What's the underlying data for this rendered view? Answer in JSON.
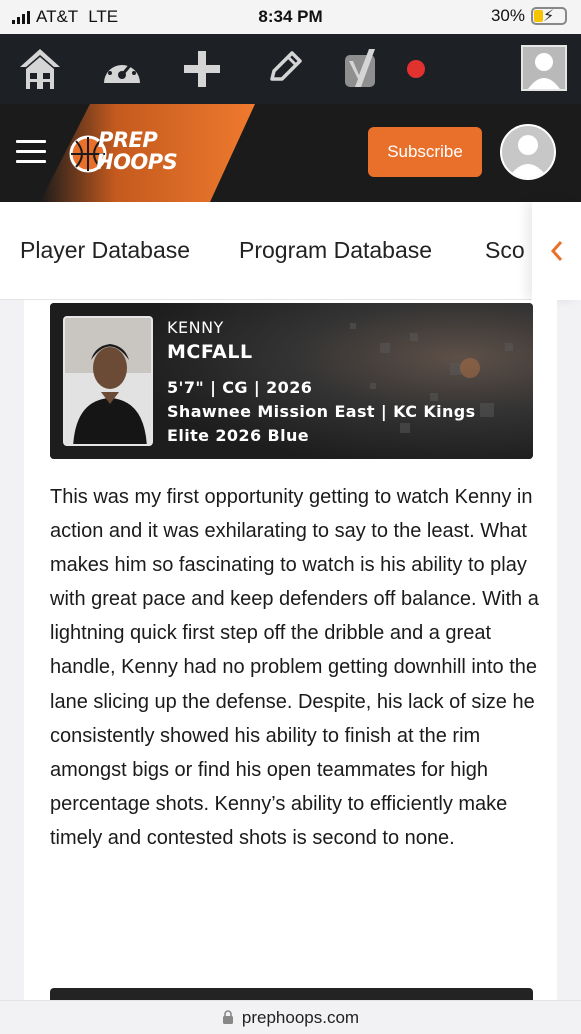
{
  "status_bar": {
    "carrier": "AT&T",
    "network": "LTE",
    "time": "8:34 PM",
    "battery_percent": "30%",
    "battery_level": 0.3
  },
  "admin_bar": {
    "icons": [
      "home-network-icon",
      "dashboard-gauge-icon",
      "add-new-icon",
      "edit-pencil-icon",
      "yoast-seo-icon",
      "notification-dot-icon",
      "admin-user-avatar"
    ],
    "notification_color": "#e2322f"
  },
  "header": {
    "logo_top": "PREP",
    "logo_bottom": "HOOPS",
    "subscribe_label": "Subscribe",
    "accent_color": "#e9702a"
  },
  "subnav": {
    "items": [
      "Player Database",
      "Program Database",
      "Sco"
    ]
  },
  "player_card": {
    "first_name": "KENNY",
    "last_name": "MCFALL",
    "height_position_class": "5'7\" | CG | 2026",
    "school_team_line1": "Shawnee Mission East | KC Kings",
    "school_team_line2": "Elite 2026 Blue"
  },
  "article": {
    "body": "This was my first opportunity getting to watch Kenny in action and it was exhilarating to say to the least. What makes him so fascinating to watch is his ability to play with great pace and keep defenders off balance. With a lightning quick first step off the dribble and a great handle, Kenny had no problem getting downhill  into the lane slicing up the defense. Despite, his lack of size he consistently showed his ability to finish at the rim amongst bigs or find his open teammates for high percentage shots. Kenny’s ability to efficiently make timely and contested shots is second to none."
  },
  "url_bar": {
    "domain": "prephoops.com"
  }
}
